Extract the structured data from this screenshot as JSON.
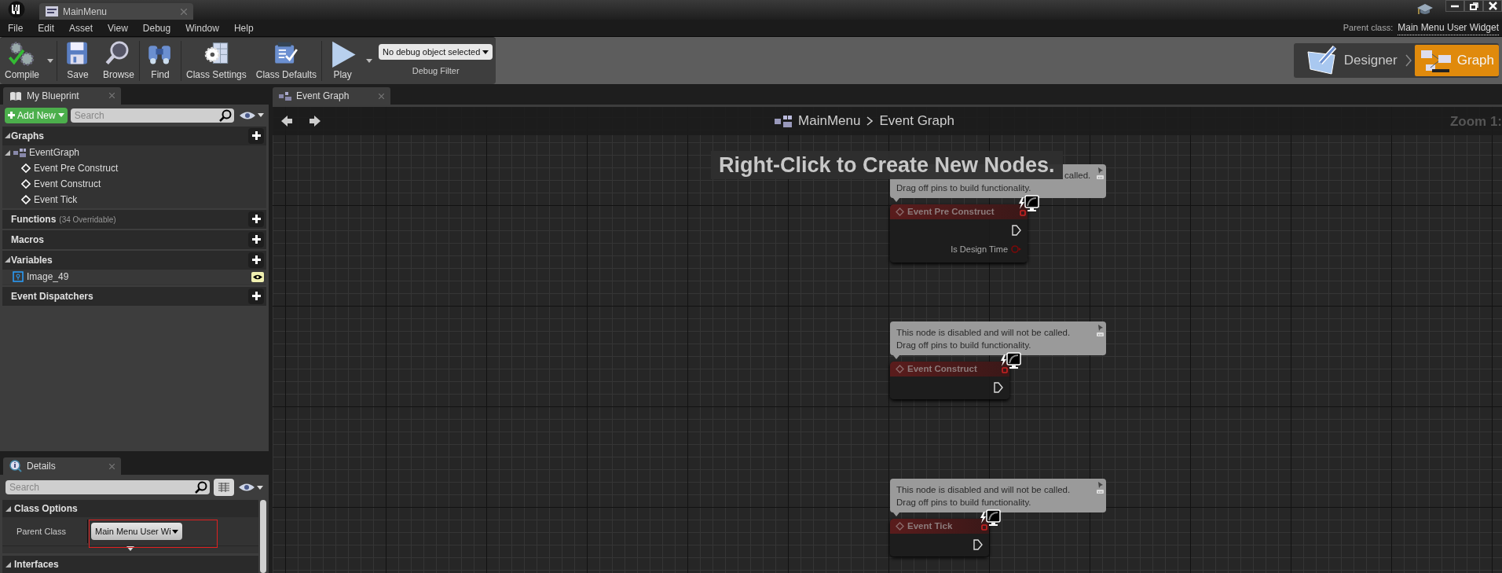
{
  "window": {
    "tab": "MainMenu"
  },
  "menu": [
    "File",
    "Edit",
    "Asset",
    "View",
    "Debug",
    "Window",
    "Help"
  ],
  "parent_class": {
    "label": "Parent class:",
    "value": "Main Menu User Widget"
  },
  "toolbar": {
    "buttons": [
      {
        "label": "Compile",
        "dropdown": true
      },
      {
        "label": "Save",
        "dropdown": false
      },
      {
        "label": "Browse",
        "dropdown": false
      },
      {
        "label": "Find",
        "dropdown": false
      },
      {
        "label": "Class Settings",
        "dropdown": false
      },
      {
        "label": "Class Defaults",
        "dropdown": false
      },
      {
        "label": "Play",
        "dropdown": true
      }
    ],
    "debug": {
      "value": "No debug object selected",
      "label": "Debug Filter"
    }
  },
  "modes": [
    {
      "label": "Designer",
      "selected": false
    },
    {
      "label": "Graph",
      "selected": true
    }
  ],
  "my_blueprint": {
    "tab": "My Blueprint",
    "add_new": "Add New",
    "search_placeholder": "Search",
    "sections": [
      {
        "title": "Graphs",
        "expanded": true,
        "items": [
          {
            "label": "EventGraph",
            "kind": "graph",
            "children": [
              {
                "label": "Event Pre Construct",
                "kind": "event"
              },
              {
                "label": "Event Construct",
                "kind": "event"
              },
              {
                "label": "Event Tick",
                "kind": "event"
              }
            ]
          }
        ]
      },
      {
        "title": "Functions",
        "note": "(34 Overridable)",
        "expanded": false
      },
      {
        "title": "Macros",
        "expanded": false
      },
      {
        "title": "Variables",
        "expanded": true,
        "items": [
          {
            "label": "Image_49",
            "kind": "variable",
            "public": true
          }
        ]
      },
      {
        "title": "Event Dispatchers",
        "expanded": false
      }
    ]
  },
  "details": {
    "tab": "Details",
    "search_placeholder": "Search",
    "sections": [
      {
        "title": "Class Options",
        "rows": [
          {
            "label": "Parent Class",
            "value": "Main Menu User Wi",
            "highlighted": true
          }
        ]
      },
      {
        "title": "Interfaces"
      }
    ]
  },
  "graph": {
    "tab": "Event Graph",
    "breadcrumb": [
      "MainMenu",
      "Event Graph"
    ],
    "zoom": "Zoom 1:",
    "hint": "Right-Click to Create New Nodes.",
    "nodes": [
      {
        "title": "Event Pre Construct",
        "disabled": true,
        "comment": {
          "covered": true,
          "lines": [
            "called.",
            "Drag off pins to build functionality."
          ]
        },
        "pins": [
          {
            "kind": "exec"
          },
          {
            "kind": "bool",
            "label": "Is Design Time"
          }
        ]
      },
      {
        "title": "Event Construct",
        "disabled": true,
        "comment": {
          "covered": false,
          "lines": [
            "This node is disabled and will not be called.",
            "Drag off pins to build functionality."
          ]
        },
        "pins": [
          {
            "kind": "exec"
          }
        ]
      },
      {
        "title": "Event Tick",
        "disabled": true,
        "comment": {
          "covered": false,
          "lines": [
            "This node is disabled and will not be called.",
            "Drag off pins to build functionality."
          ]
        },
        "pins": [
          {
            "kind": "exec"
          }
        ]
      }
    ]
  }
}
